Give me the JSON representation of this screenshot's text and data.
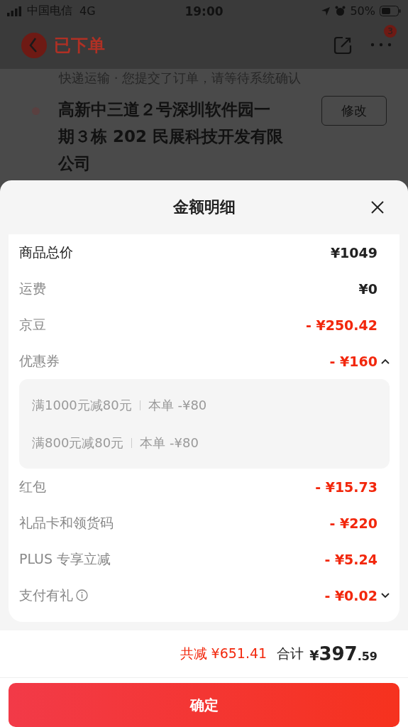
{
  "status_bar": {
    "carrier": "中国电信",
    "network": "4G",
    "time": "19:00",
    "battery": "50%"
  },
  "nav": {
    "title": "已下单",
    "badge": "3"
  },
  "order": {
    "subtitle": "快递运输 · 您提交了订单，请等待系统确认",
    "address": "高新中三道２号深圳软件园一期３栋 202 民展科技开发有限公司",
    "button": "修改"
  },
  "sheet": {
    "title": "金额明细",
    "rows": [
      {
        "kind": "total",
        "label": "商品总价",
        "amount": "¥1049"
      },
      {
        "kind": "plain",
        "label": "运费",
        "amount": "¥0"
      },
      {
        "kind": "discount",
        "label": "京豆",
        "amount": "- ¥250.42"
      },
      {
        "kind": "discount",
        "label": "优惠券",
        "amount": "- ¥160",
        "expanded": true,
        "details": [
          {
            "condition": "满1000元减80元",
            "applied": "本单 -¥80"
          },
          {
            "condition": "满800元减80元",
            "applied": "本单 -¥80"
          }
        ]
      },
      {
        "kind": "discount",
        "label": "红包",
        "amount": "- ¥15.73"
      },
      {
        "kind": "discount",
        "label": "礼品卡和领货码",
        "amount": "- ¥220"
      },
      {
        "kind": "discount",
        "label": "PLUS 专享立减",
        "amount": "- ¥5.24"
      },
      {
        "kind": "discount",
        "label": "支付有礼",
        "amount": "- ¥0.02",
        "expanded": false,
        "info": true
      }
    ]
  },
  "footer": {
    "saved_label": "共减",
    "saved_amount": "¥651.41",
    "total_label": "合计",
    "total_currency": "¥",
    "total_integer": "397",
    "total_decimal": ".59",
    "confirm": "确定"
  }
}
